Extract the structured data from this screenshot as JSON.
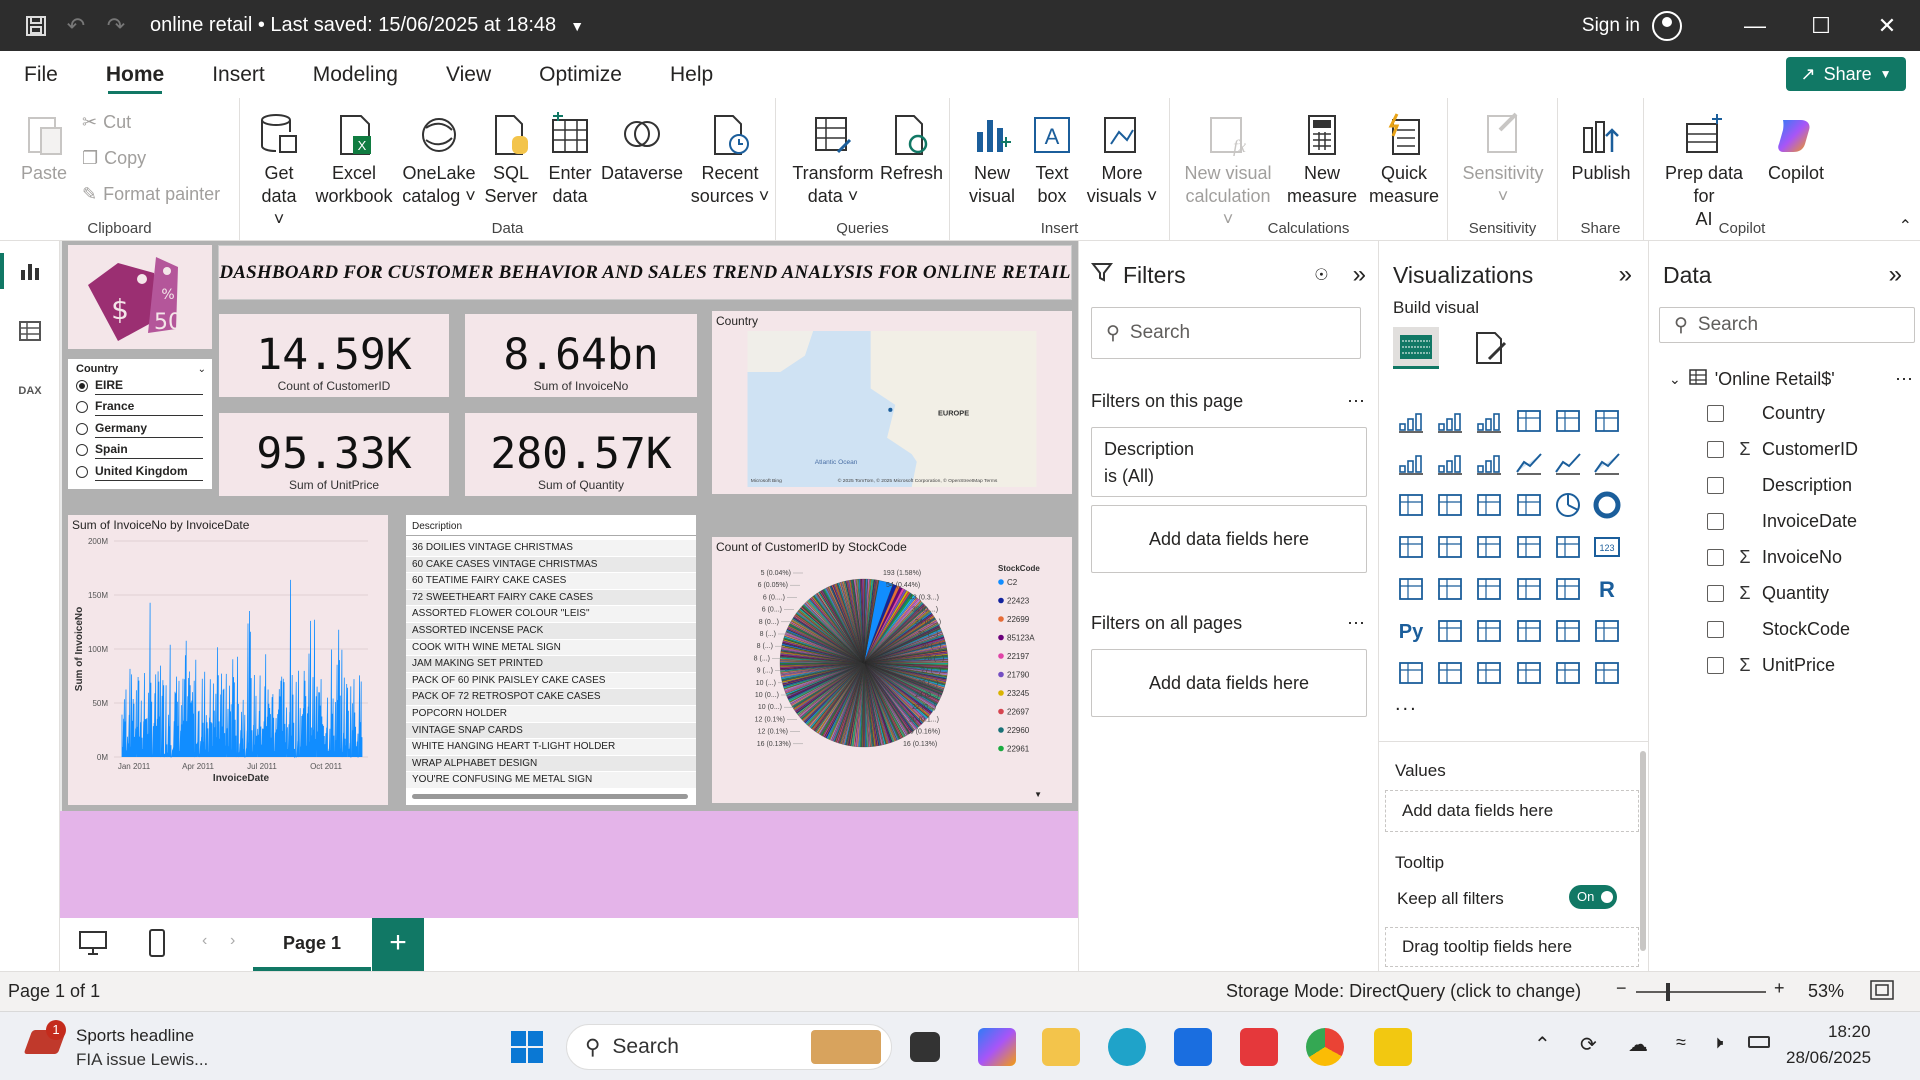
{
  "titlebar": {
    "title": "online retail • Last saved: 15/06/2025 at 18:48",
    "signin": "Sign in"
  },
  "menu": [
    "File",
    "Home",
    "Insert",
    "Modeling",
    "View",
    "Optimize",
    "Help"
  ],
  "share_label": "Share",
  "ribbon": {
    "clipboard": {
      "paste": "Paste",
      "cut": "Cut",
      "copy": "Copy",
      "format_painter": "Format painter",
      "group": "Clipboard"
    },
    "data": {
      "get_data": [
        "Get",
        "data"
      ],
      "excel": [
        "Excel",
        "workbook"
      ],
      "onelake": [
        "OneLake",
        "catalog"
      ],
      "sql": [
        "SQL",
        "Server"
      ],
      "enter": [
        "Enter",
        "data"
      ],
      "dataverse": "Dataverse",
      "recent": [
        "Recent",
        "sources"
      ],
      "group": "Data"
    },
    "queries": {
      "transform": [
        "Transform",
        "data"
      ],
      "refresh": "Refresh",
      "group": "Queries"
    },
    "insert": {
      "new_visual": [
        "New",
        "visual"
      ],
      "text_box": [
        "Text",
        "box"
      ],
      "more_visuals": [
        "More",
        "visuals"
      ],
      "group": "Insert"
    },
    "calculations": {
      "new_visual_calc": [
        "New visual",
        "calculation"
      ],
      "new_measure": [
        "New",
        "measure"
      ],
      "quick_measure": [
        "Quick",
        "measure"
      ],
      "group": "Calculations"
    },
    "sensitivity": {
      "label": "Sensitivity",
      "group": "Sensitivity"
    },
    "share": {
      "publish": "Publish",
      "group": "Share"
    },
    "copilot": {
      "prep": [
        "Prep data for",
        "AI"
      ],
      "copilot": "Copilot",
      "group": "Copilot"
    }
  },
  "report": {
    "title": "DASHBOARD FOR CUSTOMER BEHAVIOR AND SALES TREND ANALYSIS FOR ONLINE RETAIL",
    "logo_text": "50",
    "kpis": [
      {
        "value": "14.59K",
        "label": "Count of CustomerID"
      },
      {
        "value": "8.64bn",
        "label": "Sum of InvoiceNo"
      },
      {
        "value": "95.33K",
        "label": "Sum of UnitPrice"
      },
      {
        "value": "280.57K",
        "label": "Sum of Quantity"
      }
    ],
    "slicer": {
      "title": "Country",
      "items": [
        "EIRE",
        "France",
        "Germany",
        "Spain",
        "United Kingdom"
      ],
      "selected": "EIRE"
    },
    "map": {
      "title": "Country",
      "label_europe": "EUROPE",
      "label_ocean": "Atlantic Ocean",
      "credit": "© 2025 TomTom, © 2025 Microsoft Corporation, © OpenStreetMap  Terms",
      "bing": "Microsoft Bing"
    },
    "line_chart": {
      "title": "Sum of InvoiceNo by InvoiceDate",
      "xlabel": "InvoiceDate",
      "ylabel": "Sum of InvoiceNo"
    },
    "description_table": {
      "header": "Description",
      "rows": [
        "36 DOILIES VINTAGE CHRISTMAS",
        "60 CAKE CASES VINTAGE CHRISTMAS",
        "60 TEATIME FAIRY CAKE CASES",
        "72 SWEETHEART FAIRY CAKE CASES",
        "ASSORTED FLOWER COLOUR \"LEIS\"",
        "ASSORTED INCENSE PACK",
        "COOK WITH WINE METAL SIGN",
        "JAM MAKING SET PRINTED",
        "PACK OF 60 PINK PAISLEY CAKE CASES",
        "PACK OF 72 RETROSPOT CAKE CASES",
        "POPCORN HOLDER",
        "VINTAGE SNAP CARDS",
        "WHITE HANGING HEART T-LIGHT HOLDER",
        "WRAP ALPHABET DESIGN",
        "YOU'RE CONFUSING ME METAL SIGN"
      ]
    },
    "pie_chart": {
      "title": "Count of CustomerID by StockCode",
      "legend_title": "StockCode",
      "legend": [
        {
          "name": "C2",
          "color": "#118dff"
        },
        {
          "name": "22423",
          "color": "#12239e"
        },
        {
          "name": "22699",
          "color": "#e66c37"
        },
        {
          "name": "85123A",
          "color": "#6b007b"
        },
        {
          "name": "22197",
          "color": "#e044a7"
        },
        {
          "name": "21790",
          "color": "#744ec2"
        },
        {
          "name": "23245",
          "color": "#d9b300"
        },
        {
          "name": "22697",
          "color": "#d64550"
        },
        {
          "name": "22960",
          "color": "#197278"
        },
        {
          "name": "22961",
          "color": "#1aab40"
        }
      ],
      "labels_left": [
        "5 (0.04%)",
        "6 (0.05%)",
        "6 (0....)",
        "6 (0...)",
        "8 (0...)",
        "8 (...)",
        "8 (...)",
        "8 (...)",
        "9 (...)",
        "10 (...)",
        "10 (0...)",
        "10 (0...)",
        "12 (0.1%)",
        "12 (0.1%)",
        "16 (0.13%)"
      ],
      "labels_right": [
        "193 (1.58%)",
        "54 (0.44%)",
        "43 (0.3...)",
        "38 (0....)",
        "34 (0....)",
        "31 (...)",
        "30 (...)",
        "28 (...)",
        "27 (...)",
        "26 (...)",
        "24 (0...)",
        "22 (0...)",
        "20 (0.1...)",
        "19 (0.16%)",
        "16 (0.13%)"
      ]
    }
  },
  "page_tab": "Page 1",
  "filters": {
    "title": "Filters",
    "search": "Search",
    "on_page": "Filters on this page",
    "card_field": "Description",
    "card_state": "is (All)",
    "add_fields": "Add data fields here",
    "all_pages": "Filters on all pages"
  },
  "visualizations": {
    "title": "Visualizations",
    "build": "Build visual",
    "values": "Values",
    "add_fields": "Add data fields here",
    "tooltip": "Tooltip",
    "keep_filters": "Keep all filters",
    "toggle": "On",
    "drag_tooltip": "Drag tooltip fields here",
    "more": "...",
    "icon_py": "Py",
    "icon_r": "R",
    "icon_123": "123"
  },
  "data_pane": {
    "title": "Data",
    "search": "Search",
    "table": "'Online Retail$'",
    "fields": [
      {
        "name": "Country",
        "sigma": ""
      },
      {
        "name": "CustomerID",
        "sigma": "Σ"
      },
      {
        "name": "Description",
        "sigma": ""
      },
      {
        "name": "InvoiceDate",
        "sigma": ""
      },
      {
        "name": "InvoiceNo",
        "sigma": "Σ"
      },
      {
        "name": "Quantity",
        "sigma": "Σ"
      },
      {
        "name": "StockCode",
        "sigma": ""
      },
      {
        "name": "UnitPrice",
        "sigma": "Σ"
      }
    ]
  },
  "status": {
    "page": "Page 1 of 1",
    "storage": "Storage Mode: DirectQuery (click to change)",
    "zoom": "53%"
  },
  "taskbar": {
    "news_title": "Sports headline",
    "news_sub": "FIA issue Lewis...",
    "badge": "1",
    "search": "Search",
    "time": "18:20",
    "date": "28/06/2025"
  },
  "chart_data": [
    {
      "type": "line",
      "title": "Sum of InvoiceNo by InvoiceDate",
      "xlabel": "InvoiceDate",
      "ylabel": "Sum of InvoiceNo",
      "x_ticks": [
        "Jan 2011",
        "Apr 2011",
        "Jul 2011",
        "Oct 2011"
      ],
      "y_ticks": [
        "0M",
        "50M",
        "100M",
        "150M",
        "200M"
      ],
      "ylim": [
        0,
        200000000
      ]
    },
    {
      "type": "pie",
      "title": "Count of CustomerID by StockCode",
      "slices": [
        {
          "label": "193 (1.58%)",
          "value": 193
        },
        {
          "label": "54 (0.44%)",
          "value": 54
        },
        {
          "label": "43 (0.3...)",
          "value": 43
        },
        {
          "label": "38 (0....)",
          "value": 38
        },
        {
          "label": "34 (0....)",
          "value": 34
        },
        {
          "label": "31 (...)",
          "value": 31
        },
        {
          "label": "30 (...)",
          "value": 30
        },
        {
          "label": "28 (...)",
          "value": 28
        },
        {
          "label": "27 (...)",
          "value": 27
        },
        {
          "label": "26 (...)",
          "value": 26
        },
        {
          "label": "24 (0...)",
          "value": 24
        },
        {
          "label": "22 (0...)",
          "value": 22
        },
        {
          "label": "20 (0.1...)",
          "value": 20
        },
        {
          "label": "19 (0.16%)",
          "value": 19
        },
        {
          "label": "16 (0.13%)",
          "value": 16
        },
        {
          "label": "16 (0.13%)",
          "value": 16
        },
        {
          "label": "12 (0.1%)",
          "value": 12
        },
        {
          "label": "12 (0.1%)",
          "value": 12
        },
        {
          "label": "10 (0...)",
          "value": 10
        },
        {
          "label": "10 (0...)",
          "value": 10
        },
        {
          "label": "10 (...)",
          "value": 10
        },
        {
          "label": "9 (...)",
          "value": 9
        },
        {
          "label": "8 (...)",
          "value": 8
        },
        {
          "label": "8 (...)",
          "value": 8
        },
        {
          "label": "8 (...)",
          "value": 8
        },
        {
          "label": "8 (0...)",
          "value": 8
        },
        {
          "label": "6 (0...)",
          "value": 6
        },
        {
          "label": "6 (0....)",
          "value": 6
        },
        {
          "label": "6 (0.05%)",
          "value": 6
        },
        {
          "label": "5 (0.04%)",
          "value": 5
        }
      ]
    }
  ]
}
